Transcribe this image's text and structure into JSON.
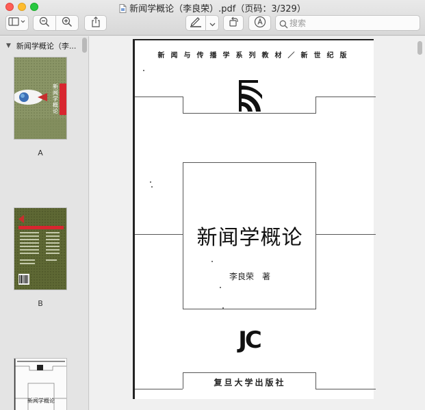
{
  "window": {
    "title": "新闻学概论（李良荣）.pdf（页码：3/329）"
  },
  "toolbar": {
    "search_placeholder": "搜索"
  },
  "icons": {
    "document": "pdf-document-icon",
    "sidebar": "sidebar-toggle-icon",
    "zoom_out": "zoom-out-icon",
    "zoom_in": "zoom-in-icon",
    "share": "share-icon",
    "markup": "pen-icon",
    "rotate": "rotate-icon",
    "annotate": "markup-circle-icon",
    "search": "search-icon"
  },
  "sidebar": {
    "title": "新闻学概论（李...",
    "thumbnails": [
      {
        "label": "A",
        "cover_text": "新闻学概论"
      },
      {
        "label": "B"
      },
      {
        "label": "",
        "cover_text": "新闻学概论"
      }
    ]
  },
  "page": {
    "series": "新闻与传播学系列教材／新世纪版",
    "title": "新闻学概论",
    "author": "李良荣　著",
    "logo": "JC",
    "publisher": "复旦大学出版社"
  },
  "colors": {
    "close": "#fe5f57",
    "minimize": "#febc2e",
    "maximize": "#28c840",
    "cover_red": "#d8262f"
  }
}
